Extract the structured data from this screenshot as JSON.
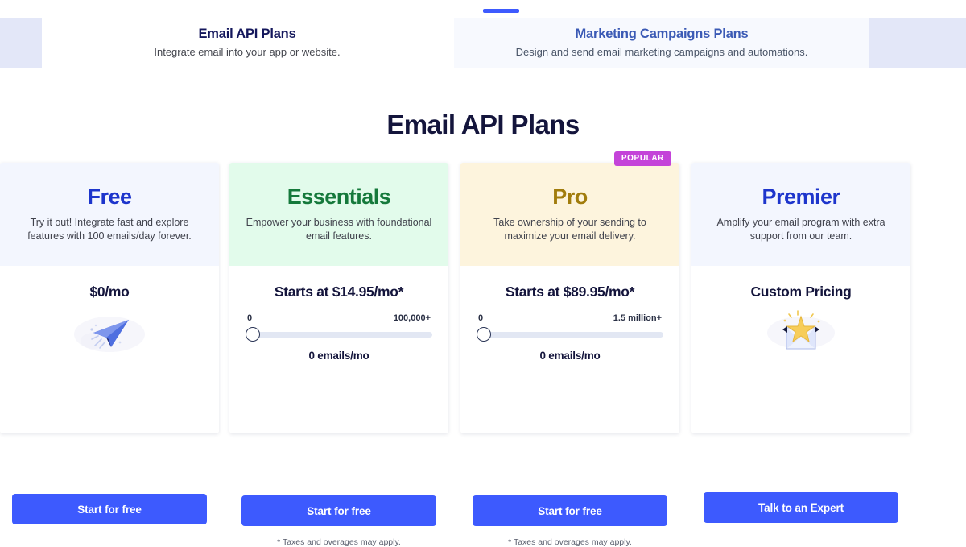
{
  "tabs": [
    {
      "id": "email-api",
      "title": "Email API Plans",
      "subtitle": "Integrate email into your app or website.",
      "active": false
    },
    {
      "id": "marketing-campaigns",
      "title": "Marketing Campaigns Plans",
      "subtitle": "Design and send email marketing campaigns and automations.",
      "active": true
    }
  ],
  "page": {
    "heading": "Email API Plans",
    "accent_color": "#3d5afe",
    "badge_color": "#c443d9"
  },
  "plans": [
    {
      "name": "Free",
      "description": "Try it out! Integrate fast and explore features with 100 emails/day forever.",
      "price": "$0/mo",
      "cta": "Start for free",
      "illustration": "paper-airplane-illustration",
      "has_slider": false,
      "footnote": "",
      "badge": ""
    },
    {
      "name": "Essentials",
      "description": "Empower your business with foundational email features.",
      "price": "Starts at $14.95/mo*",
      "cta": "Start for free",
      "illustration": "",
      "has_slider": true,
      "slider": {
        "min_label": "0",
        "max_label": "100,000+",
        "value_label": "0 emails/mo",
        "position_percent": 0
      },
      "footnote": "* Taxes and overages may apply.",
      "badge": ""
    },
    {
      "name": "Pro",
      "description": "Take ownership of your sending to maximize your email delivery.",
      "price": "Starts at $89.95/mo*",
      "cta": "Start for free",
      "illustration": "",
      "has_slider": true,
      "slider": {
        "min_label": "0",
        "max_label": "1.5 million+",
        "value_label": "0 emails/mo",
        "position_percent": 0
      },
      "footnote": "* Taxes and overages may apply.",
      "badge": "POPULAR"
    },
    {
      "name": "Premier",
      "description": "Amplify your email program with extra support from our team.",
      "price": "Custom Pricing",
      "cta": "Talk to an Expert",
      "illustration": "envelope-star-illustration",
      "has_slider": false,
      "footnote": "",
      "badge": ""
    }
  ]
}
